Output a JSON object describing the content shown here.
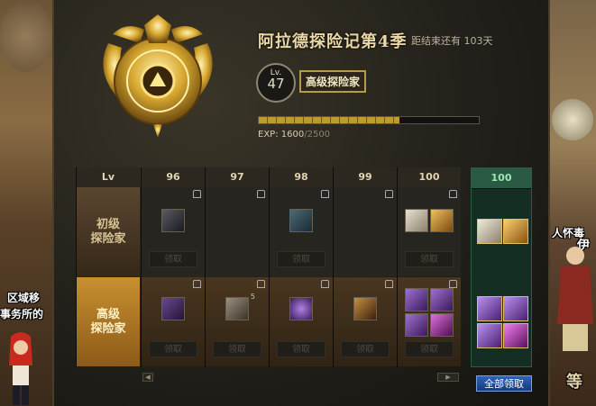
{
  "season": {
    "title": "阿拉德探险记第4季",
    "remaining": "距结束还有 103天"
  },
  "player": {
    "lv_prefix": "Lv.",
    "level": "47",
    "rank": "高级探险家",
    "exp_label": "EXP:",
    "exp_current": "1600",
    "exp_sep": "/",
    "exp_max": "2500",
    "exp_fraction": 0.64
  },
  "table": {
    "lv_header": "Lv",
    "levels": [
      "96",
      "97",
      "98",
      "99",
      "100"
    ],
    "final_level": "100",
    "row1_label_line1": "初级",
    "row1_label_line2": "探险家",
    "row2_label_line1": "高级",
    "row2_label_line2": "探险家",
    "claim_label": "领取",
    "claim_all_label": "全部领取"
  },
  "items": {
    "row1_col96": "dark-scroll-icon",
    "row1_col98": "gear-box-icon",
    "row1_col100_a": "silver-chest-icon",
    "row1_col100_b": "gold-chest-icon",
    "row2_col96": "purple-book-icon",
    "row2_col97": "crate-icon",
    "row2_col97_count": "5",
    "row2_col98": "purple-orb-icon",
    "row2_col99": "gold-scroll-icon",
    "row2_col100": [
      "purple-chest-icon",
      "purple-chest-icon",
      "purple-chest-icon",
      "purple-armor-icon"
    ]
  },
  "world": {
    "npc_left_1": "区域移",
    "npc_left_2": "事务所的",
    "npc_right_1": "人怀毒",
    "npc_right_2": "伊",
    "npc_bottom": "等"
  },
  "colors": {
    "gold": "#c09b2c",
    "final_column_header": "#9fe6b6",
    "claim_all": "#3062b8"
  }
}
